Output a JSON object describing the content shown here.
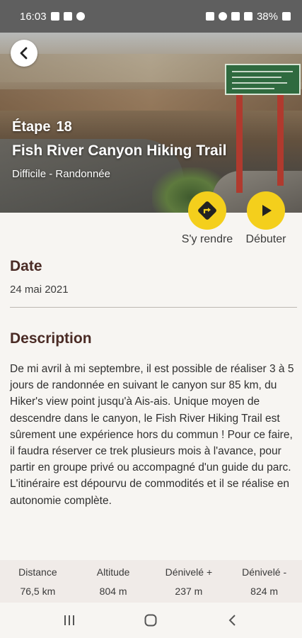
{
  "status": {
    "time": "16:03",
    "battery": "38%"
  },
  "hero": {
    "stage_label": "Étape",
    "stage_number": "18",
    "title": "Fish River Canyon Hiking Trail",
    "subtitle": "Difficile - Randonnée"
  },
  "actions": {
    "go_label": "S'y rendre",
    "start_label": "Débuter"
  },
  "date": {
    "heading": "Date",
    "value": "24 mai 2021"
  },
  "description": {
    "heading": "Description",
    "text": "De mi avril à mi septembre, il est possible de réaliser 3 à 5 jours de randonnée en suivant le canyon sur 85 km, du Hiker's view point jusqu'à Ais-ais. Unique moyen de descendre dans le canyon, le Fish River Hiking Trail est sûrement une expérience hors du commun ! Pour ce faire, il faudra réserver ce trek plusieurs mois à l'avance, pour partir en groupe privé ou accompagné d'un guide du parc. L'itinéraire est dépourvu de commodités et il se réalise en autonomie complète."
  },
  "stats": [
    {
      "label": "Distance",
      "value": "76,5 km"
    },
    {
      "label": "Altitude",
      "value": "804 m"
    },
    {
      "label": "Dénivelé +",
      "value": "237 m"
    },
    {
      "label": "Dénivelé -",
      "value": "824 m"
    }
  ],
  "colors": {
    "accent": "#f4cf1c",
    "heading": "#4a2b25"
  }
}
